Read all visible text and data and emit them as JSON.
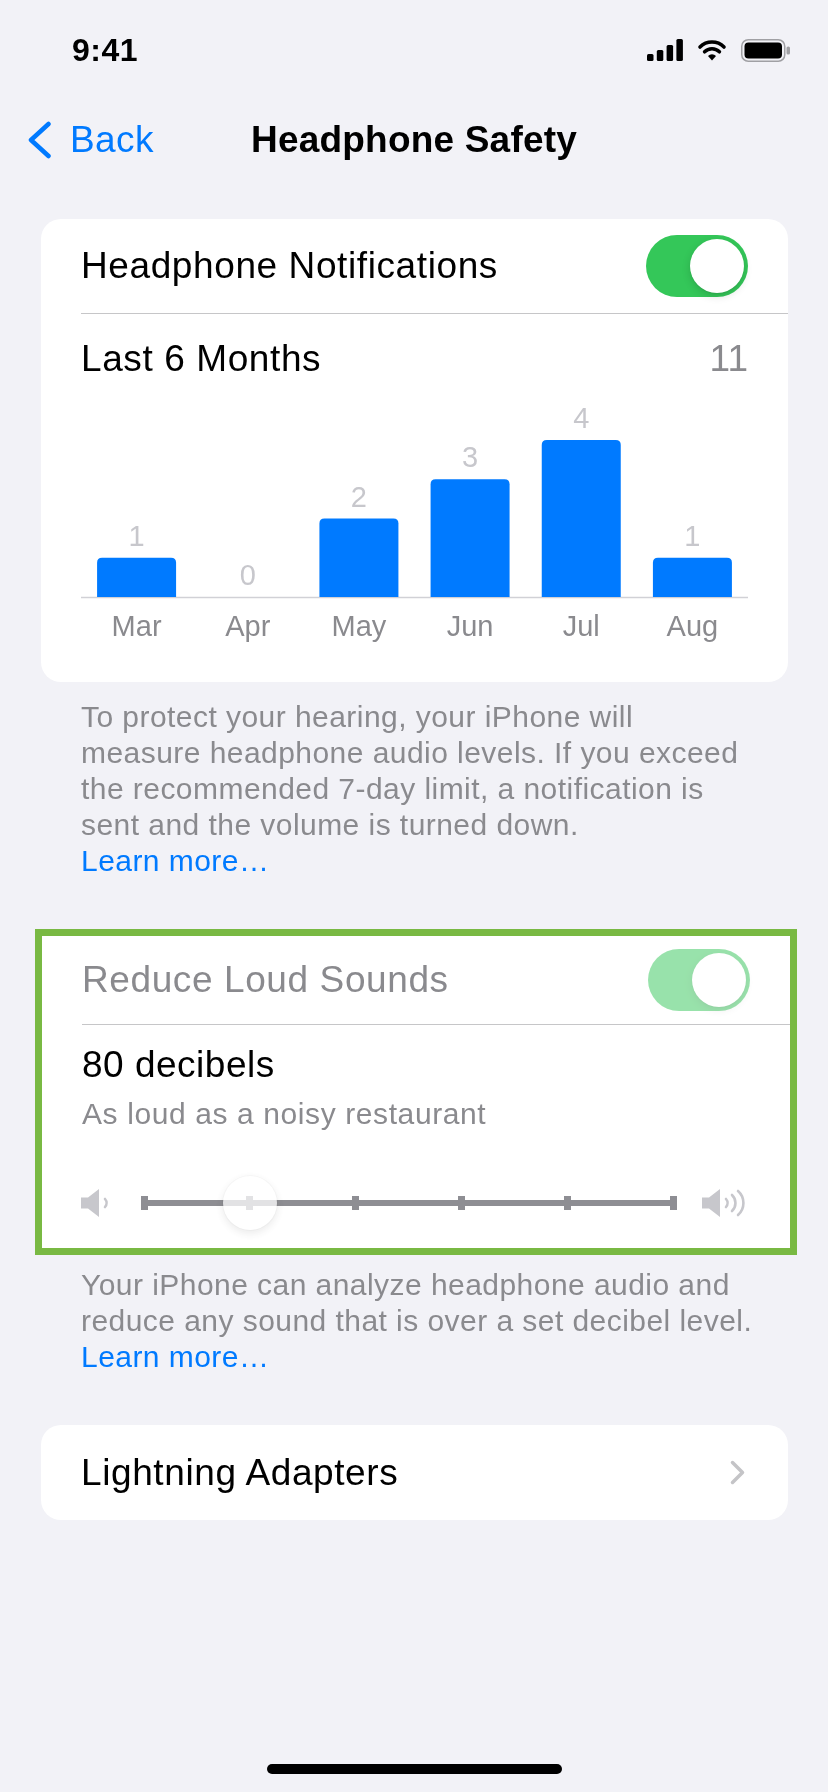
{
  "status_bar": {
    "time": "9:41"
  },
  "nav": {
    "back": "Back",
    "title": "Headphone Safety"
  },
  "notifications": {
    "label": "Headphone Notifications",
    "on": true,
    "period": "Last 6 Months",
    "total": "11",
    "chart_data": {
      "type": "bar",
      "categories": [
        "Mar",
        "Apr",
        "May",
        "Jun",
        "Jul",
        "Aug"
      ],
      "values": [
        1,
        0,
        2,
        3,
        4,
        1
      ],
      "data_labels": true
    }
  },
  "notifications_footer": {
    "text": "To protect your hearing, your iPhone will measure headphone audio levels. If you exceed the recommended 7-day limit, a notification is sent and the volume is turned down.",
    "link": "Learn more…"
  },
  "reduce_loud_sounds": {
    "highlighted": true,
    "label": "Reduce Loud Sounds",
    "on": true,
    "disabled": true,
    "value": "80 decibels",
    "description": "As loud as a noisy restaurant",
    "level": 0.2
  },
  "reduce_footer": {
    "text": "Your iPhone can analyze headphone audio and reduce any sound that is over a set decibel level.",
    "link": "Learn more…"
  },
  "lightning_adapters": {
    "label": "Lightning Adapters"
  }
}
